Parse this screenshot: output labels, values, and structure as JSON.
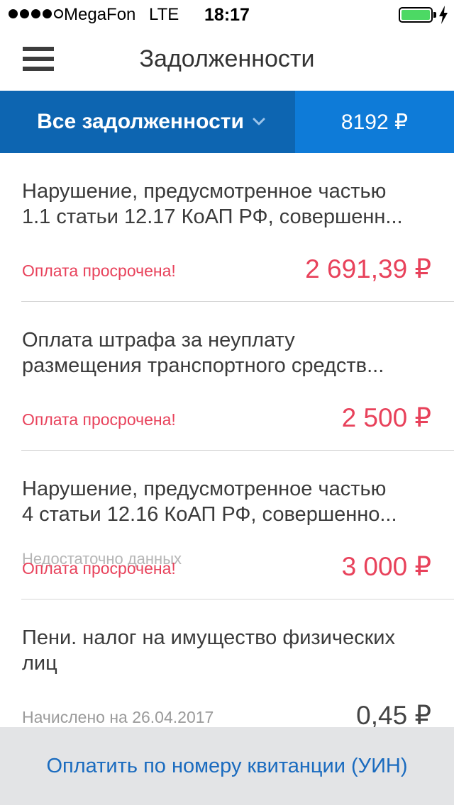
{
  "status_bar": {
    "carrier": "MegaFon",
    "network": "LTE",
    "time": "18:17",
    "signal_bars_filled": 4,
    "signal_bars_total": 5,
    "battery_level": 1.0
  },
  "nav": {
    "title": "Задолженности",
    "menu_icon": "hamburger-menu-icon"
  },
  "filter": {
    "selected": "Все задолженности",
    "total": "8192 ₽"
  },
  "debts": [
    {
      "title_line1": "Нарушение, предусмотренное частью",
      "title_line2": "1.1 статьи 12.17 КоАП РФ, совершенн...",
      "note": "",
      "status": "Оплата просрочена!",
      "amount": "2 691,39 ₽"
    },
    {
      "title_line1": "Оплата штрафа за неуплату",
      "title_line2": "размещения транспортного средств...",
      "note": "",
      "status": "Оплата просрочена!",
      "amount": "2 500 ₽"
    },
    {
      "title_line1": "Нарушение, предусмотренное частью",
      "title_line2": "4 статьи 12.16 КоАП РФ, совершенно...",
      "note": "Недостаточно данных",
      "status": "Оплата просрочена!",
      "amount": "3 000 ₽"
    },
    {
      "title_line1": "Пени. налог на имущество физических",
      "title_line2": "лиц",
      "note": "",
      "status": "Начислено на 26.04.2017",
      "amount": "0,45 ₽"
    }
  ],
  "bottom_action": {
    "label": "Оплатить по номеру квитанции (УИН)"
  },
  "colors": {
    "primary_blue": "#0d65b1",
    "secondary_blue": "#0e7bd8",
    "overdue_red": "#e8425b",
    "link_blue": "#1a6bbf",
    "battery_green": "#4cd964"
  }
}
